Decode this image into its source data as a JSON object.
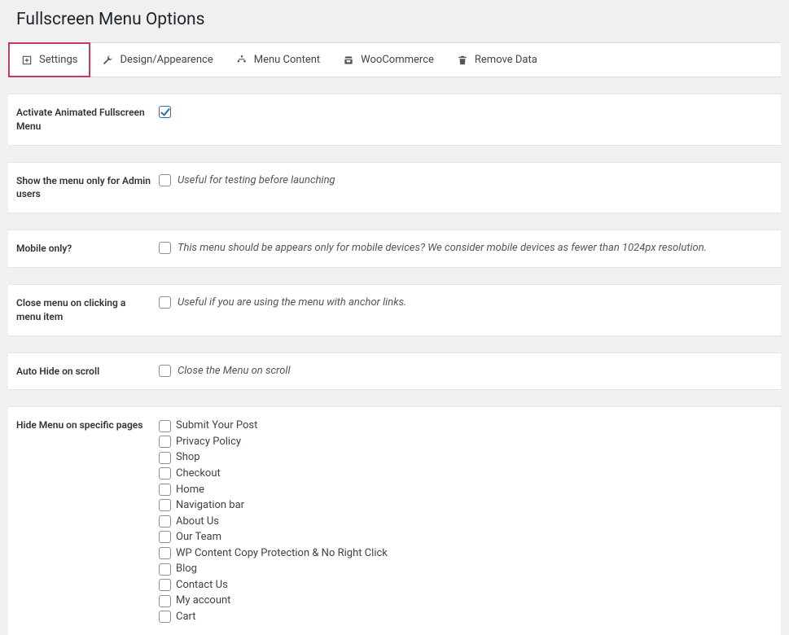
{
  "header": {
    "title": "Fullscreen Menu Options"
  },
  "tabs": [
    {
      "label": "Settings",
      "icon": "square-plus-icon"
    },
    {
      "label": "Design/Appearence",
      "icon": "wrench-icon"
    },
    {
      "label": "Menu Content",
      "icon": "sitemap-icon"
    },
    {
      "label": "WooCommerce",
      "icon": "shop-icon"
    },
    {
      "label": "Remove Data",
      "icon": "trash-icon"
    }
  ],
  "settings": {
    "activate": {
      "label": "Activate Animated Fullscreen Menu",
      "checked": true
    },
    "admin_only": {
      "label": "Show the menu only for Admin users",
      "checked": false,
      "desc": "Useful for testing before launching"
    },
    "mobile_only": {
      "label": "Mobile only?",
      "checked": false,
      "desc": "This menu should be appears only for mobile devices? We consider mobile devices as fewer than 1024px resolution."
    },
    "close_on_click": {
      "label": "Close menu on clicking a menu item",
      "checked": false,
      "desc": "Useful if you are using the menu with anchor links."
    },
    "auto_hide": {
      "label": "Auto Hide on scroll",
      "checked": false,
      "desc": "Close the Menu on scroll"
    },
    "hide_pages": {
      "label": "Hide Menu on specific pages",
      "items": [
        {
          "label": "Submit Your Post",
          "checked": false
        },
        {
          "label": "Privacy Policy",
          "checked": false
        },
        {
          "label": "Shop",
          "checked": false
        },
        {
          "label": "Checkout",
          "checked": false
        },
        {
          "label": "Home",
          "checked": false
        },
        {
          "label": "Navigation bar",
          "checked": false
        },
        {
          "label": "About Us",
          "checked": false
        },
        {
          "label": "Our Team",
          "checked": false
        },
        {
          "label": "WP Content Copy Protection & No Right Click",
          "checked": false
        },
        {
          "label": "Blog",
          "checked": false
        },
        {
          "label": "Contact Us",
          "checked": false
        },
        {
          "label": "My account",
          "checked": false
        },
        {
          "label": "Cart",
          "checked": false
        }
      ]
    }
  }
}
